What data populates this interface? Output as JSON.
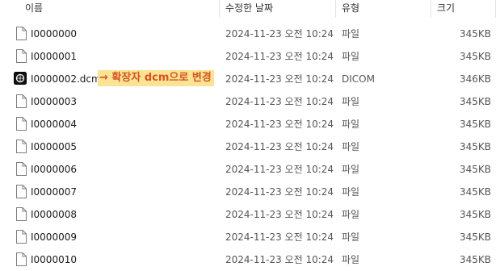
{
  "header": {
    "col_name": "이름",
    "col_date": "수정한 날짜",
    "col_type": "유형",
    "col_size": "크기",
    "sort_glyph": "^"
  },
  "annotation": {
    "text": "→ 확장자 dcm으로 변경"
  },
  "rows": [
    {
      "name": "I0000000",
      "date": "2024-11-23 오전 10:24",
      "type": "파일",
      "size": "345KB",
      "icon": "file-icon"
    },
    {
      "name": "I0000001",
      "date": "2024-11-23 오전 10:24",
      "type": "파일",
      "size": "345KB",
      "icon": "file-icon"
    },
    {
      "name": "I0000002.dcm",
      "date": "2024-11-23 오전 10:24",
      "type": "DICOM",
      "size": "346KB",
      "icon": "dicom-file-icon"
    },
    {
      "name": "I0000003",
      "date": "2024-11-23 오전 10:24",
      "type": "파일",
      "size": "345KB",
      "icon": "file-icon"
    },
    {
      "name": "I0000004",
      "date": "2024-11-23 오전 10:24",
      "type": "파일",
      "size": "345KB",
      "icon": "file-icon"
    },
    {
      "name": "I0000005",
      "date": "2024-11-23 오전 10:24",
      "type": "파일",
      "size": "345KB",
      "icon": "file-icon"
    },
    {
      "name": "I0000006",
      "date": "2024-11-23 오전 10:24",
      "type": "파일",
      "size": "345KB",
      "icon": "file-icon"
    },
    {
      "name": "I0000007",
      "date": "2024-11-23 오전 10:24",
      "type": "파일",
      "size": "345KB",
      "icon": "file-icon"
    },
    {
      "name": "I0000008",
      "date": "2024-11-23 오전 10:24",
      "type": "파일",
      "size": "345KB",
      "icon": "file-icon"
    },
    {
      "name": "I0000009",
      "date": "2024-11-23 오전 10:24",
      "type": "파일",
      "size": "345KB",
      "icon": "file-icon"
    },
    {
      "name": "I0000010",
      "date": "2024-11-23 오전 10:24",
      "type": "파일",
      "size": "345KB",
      "icon": "file-icon"
    }
  ],
  "colors": {
    "highlight_bg": "#fbe396",
    "highlight_text": "#d6531c"
  }
}
